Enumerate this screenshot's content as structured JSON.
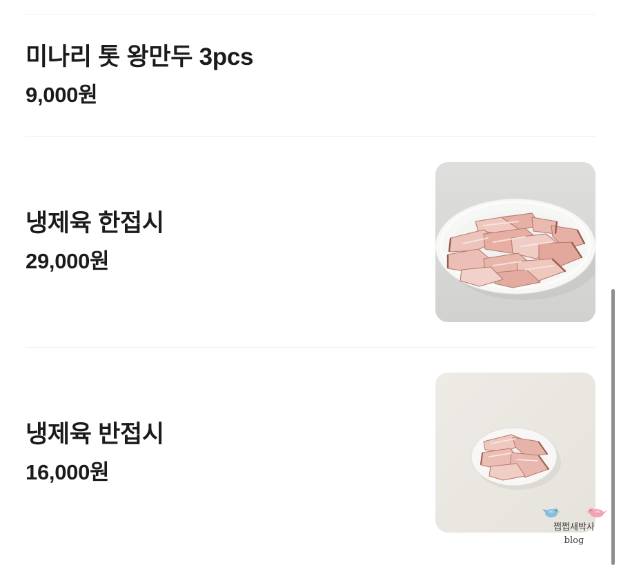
{
  "menu": {
    "items": [
      {
        "name": "미나리 톳 왕만두 3pcs",
        "price": "9,000원"
      },
      {
        "name": "냉제육 한접시",
        "price": "29,000원"
      },
      {
        "name": "냉제육 반접시",
        "price": "16,000원"
      }
    ]
  },
  "watermark": {
    "title": "쩝쩝새박사",
    "subtitle": "blog"
  },
  "colors": {
    "background": "#ffffff",
    "text": "#1b1b1b",
    "divider": "#efefef",
    "scrollbar": "#8e8e8e"
  }
}
